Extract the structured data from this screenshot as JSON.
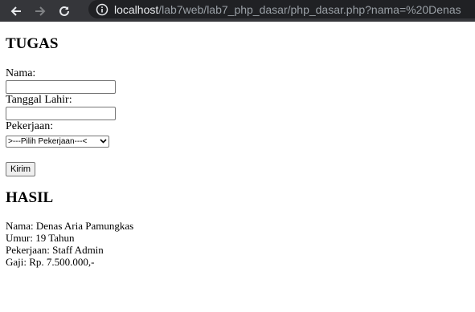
{
  "browser": {
    "url_host": "localhost",
    "url_path": "/lab7web/lab7_php_dasar/php_dasar.php?nama=%20Denas",
    "back_icon": "arrow-left-icon",
    "forward_icon": "arrow-right-icon",
    "reload_icon": "reload-icon",
    "info_icon": "info-icon"
  },
  "form": {
    "title": "TUGAS",
    "nama_label": "Nama:",
    "nama_value": "",
    "tanggal_label": "Tanggal Lahir:",
    "tanggal_value": "",
    "pekerjaan_label": "Pekerjaan:",
    "pekerjaan_selected": ">---Pilih Pekerjaan---<",
    "submit_label": "Kirim"
  },
  "result": {
    "title": "HASIL",
    "lines": [
      "Nama: Denas Aria Pamungkas",
      "Umur: 19 Tahun",
      "Pekerjaan: Staff Admin",
      "Gaji: Rp. 7.500.000,-"
    ]
  }
}
